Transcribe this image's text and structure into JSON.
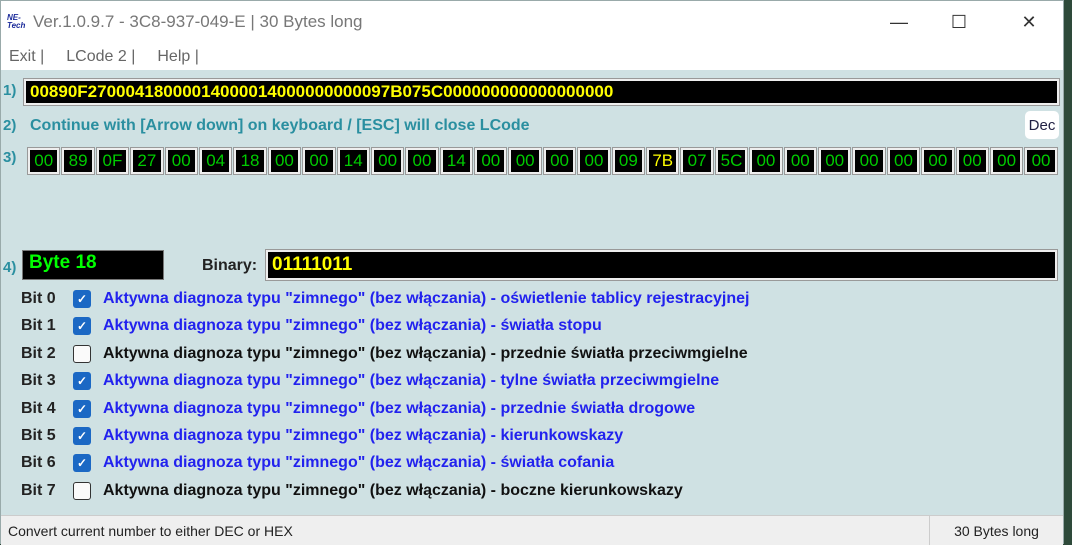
{
  "window": {
    "title": "Ver.1.0.9.7 -   3C8-937-049-E | 30 Bytes long",
    "logo": "NE-Tech",
    "minimize": "—",
    "maximize": "☐",
    "close": "✕"
  },
  "menu": [
    "Exit |",
    "LCode 2 |",
    "Help |"
  ],
  "labels": {
    "n1": "1)",
    "n2": "2)",
    "n3": "3)",
    "n4": "4)"
  },
  "hex_string": "00890F27000418000014000014000000000097B075C000000000000000000",
  "hint": "Continue with [Arrow down] on keyboard / [ESC] will close LCode",
  "dec_button": "Dec",
  "bytes": [
    "00",
    "89",
    "0F",
    "27",
    "00",
    "04",
    "18",
    "00",
    "00",
    "14",
    "00",
    "00",
    "14",
    "00",
    "00",
    "00",
    "00",
    "09",
    "7B",
    "07",
    "5C",
    "00",
    "00",
    "00",
    "00",
    "00",
    "00",
    "00",
    "00",
    "00"
  ],
  "selected_byte_index": 18,
  "byte_label": "Byte 18",
  "binary_label": "Binary:",
  "binary_value": "01111011",
  "bits": [
    {
      "name": "Bit 0",
      "checked": true,
      "desc": "Aktywna diagnoza typu \"zimnego\" (bez włączania) - oświetlenie tablicy rejestracyjnej"
    },
    {
      "name": "Bit 1",
      "checked": true,
      "desc": "Aktywna diagnoza typu \"zimnego\" (bez włączania) - światła stopu"
    },
    {
      "name": "Bit 2",
      "checked": false,
      "desc": "Aktywna diagnoza typu \"zimnego\" (bez włączania) - przednie światła przeciwmgielne"
    },
    {
      "name": "Bit 3",
      "checked": true,
      "desc": "Aktywna diagnoza typu \"zimnego\" (bez włączania) - tylne światła przeciwmgielne"
    },
    {
      "name": "Bit 4",
      "checked": true,
      "desc": "Aktywna diagnoza typu \"zimnego\" (bez włączania) - przednie światła drogowe"
    },
    {
      "name": "Bit 5",
      "checked": true,
      "desc": "Aktywna diagnoza typu \"zimnego\" (bez włączania) - kierunkowskazy"
    },
    {
      "name": "Bit 6",
      "checked": true,
      "desc": "Aktywna diagnoza typu \"zimnego\" (bez włączania) - światła cofania"
    },
    {
      "name": "Bit 7",
      "checked": false,
      "desc": "Aktywna diagnoza typu \"zimnego\" (bez włączania) - boczne kierunkowskazy"
    }
  ],
  "status": {
    "left": "Convert current number to either DEC or HEX",
    "right": "30 Bytes long"
  }
}
